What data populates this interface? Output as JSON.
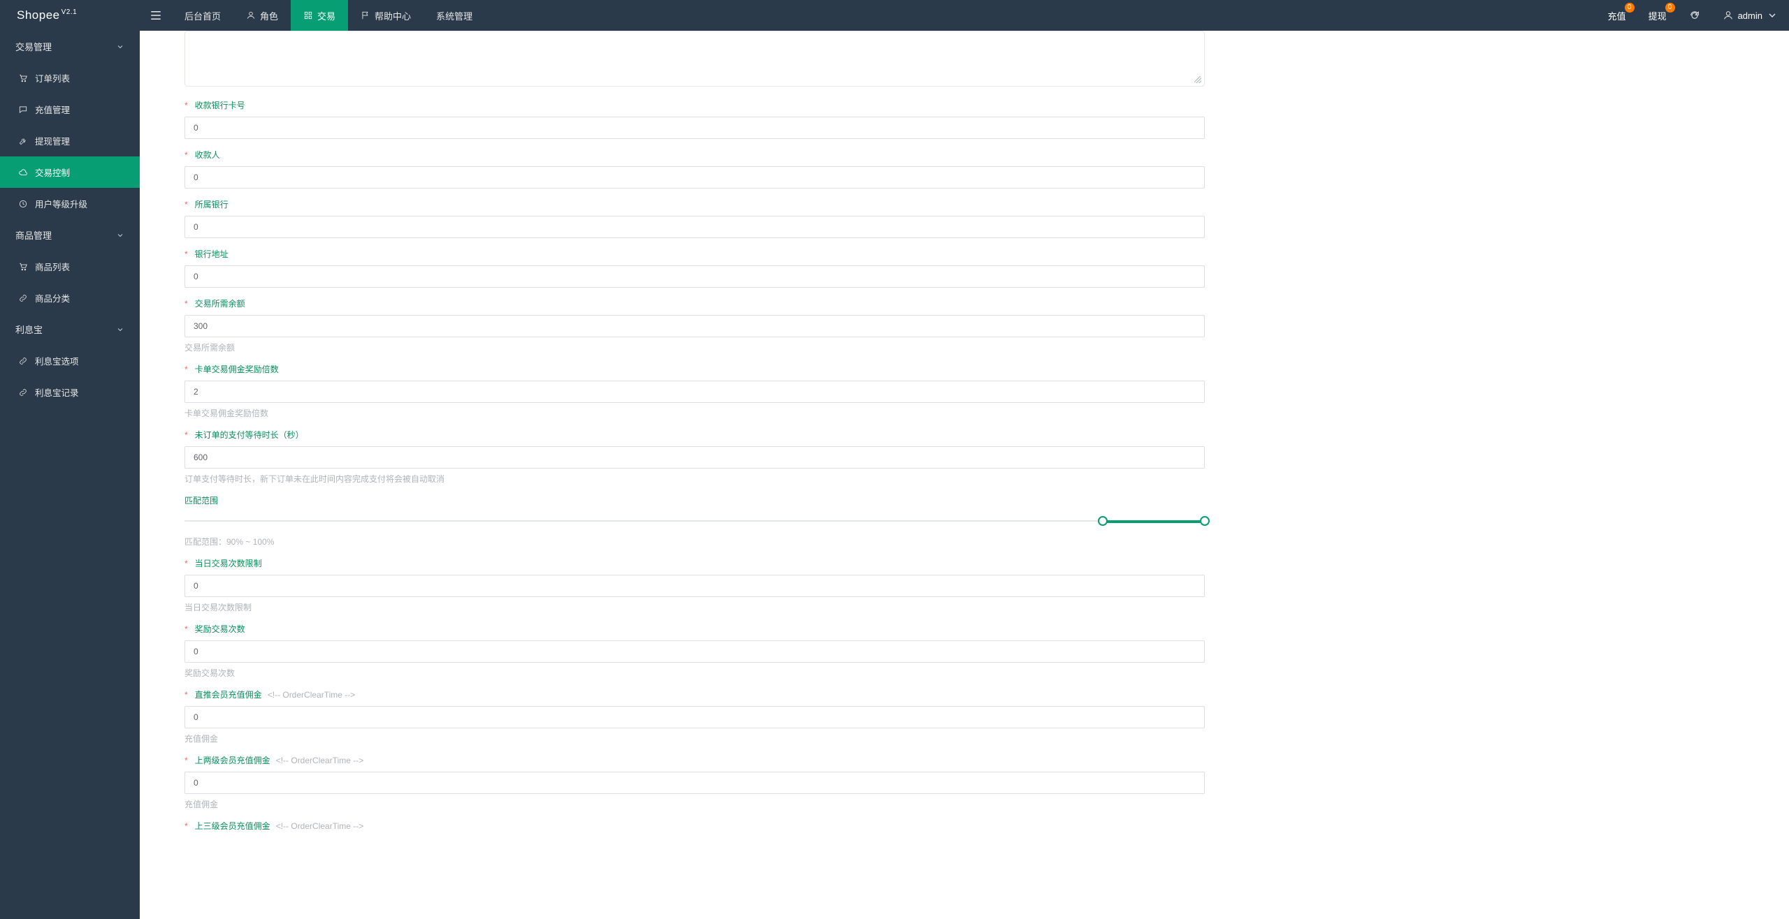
{
  "brand": {
    "name": "Shopee",
    "version": "V2.1"
  },
  "top_tabs": [
    {
      "label": "后台首页",
      "icon": ""
    },
    {
      "label": "角色",
      "icon": "user"
    },
    {
      "label": "交易",
      "icon": "grid",
      "active": true
    },
    {
      "label": "帮助中心",
      "icon": "flag"
    },
    {
      "label": "系统管理",
      "icon": ""
    }
  ],
  "header_right": {
    "recharge": {
      "label": "充值",
      "badge": "0"
    },
    "withdraw": {
      "label": "提现",
      "badge": "0"
    },
    "refresh_title": "刷新",
    "user": {
      "name": "admin"
    }
  },
  "sidebar": {
    "groups": [
      {
        "title": "交易管理",
        "items": [
          {
            "label": "订单列表",
            "icon": "cart"
          },
          {
            "label": "充值管理",
            "icon": "chat"
          },
          {
            "label": "提现管理",
            "icon": "tool"
          },
          {
            "label": "交易控制",
            "icon": "cloud",
            "active": true
          },
          {
            "label": "用户等级升级",
            "icon": "clock"
          }
        ]
      },
      {
        "title": "商品管理",
        "items": [
          {
            "label": "商品列表",
            "icon": "cart"
          },
          {
            "label": "商品分类",
            "icon": "link"
          }
        ]
      },
      {
        "title": "利息宝",
        "items": [
          {
            "label": "利息宝选项",
            "icon": "link"
          },
          {
            "label": "利息宝记录",
            "icon": "link"
          }
        ]
      }
    ]
  },
  "form": {
    "bank_card": {
      "label": "收款银行卡号",
      "value": "0"
    },
    "payee": {
      "label": "收款人",
      "value": "0"
    },
    "bank": {
      "label": "所属银行",
      "value": "0"
    },
    "bank_addr": {
      "label": "银行地址",
      "value": "0"
    },
    "balance": {
      "label": "交易所需余额",
      "value": "300",
      "hint": "交易所需余额"
    },
    "commission_multiplier": {
      "label": "卡单交易佣金奖励倍数",
      "value": "2",
      "hint": "卡单交易佣金奖励倍数"
    },
    "pay_wait": {
      "label": "未订单的支付等待时长（秒）",
      "value": "600",
      "hint": "订单支付等待时长，新下订单未在此时间内容完成支付将会被自动取消"
    },
    "match_range": {
      "label": "匹配范围",
      "from": 90,
      "to": 100,
      "hint": "匹配范围：90% ~ 100%"
    },
    "daily_limit": {
      "label": "当日交易次数限制",
      "value": "0",
      "hint": "当日交易次数限制"
    },
    "reward_times": {
      "label": "奖励交易次数",
      "value": "0",
      "hint": "奖励交易次数"
    },
    "direct_recharge": {
      "label": "直推会员充值佣金",
      "note": "<!-- OrderClearTime -->",
      "value": "0",
      "hint": "充值佣金"
    },
    "two_level_recharge": {
      "label": "上两级会员充值佣金",
      "note": "<!-- OrderClearTime -->",
      "value": "0",
      "hint": "充值佣金"
    },
    "three_level_recharge": {
      "label": "上三级会员充值佣金",
      "note": "<!-- OrderClearTime -->"
    }
  }
}
